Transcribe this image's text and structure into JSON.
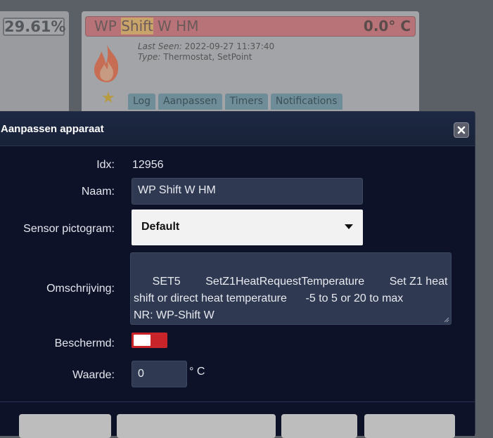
{
  "background": {
    "left_card": {
      "value": "29.61%"
    },
    "device_card": {
      "name_before": "WP ",
      "name_highlight": "Shift",
      "name_after": " W HM",
      "value": "0.0° C",
      "last_seen_label": "Last Seen:",
      "last_seen_value": "2022-09-27 11:37:40",
      "type_label": "Type:",
      "type_value": "Thermostat, SetPoint",
      "tabs": [
        "Log",
        "Aanpassen",
        "Timers",
        "Notifications"
      ]
    }
  },
  "dialog": {
    "title": "Aanpassen apparaat",
    "fields": {
      "idx": {
        "label": "Idx:",
        "value": "12956"
      },
      "naam": {
        "label": "Naam:",
        "value": "WP Shift W HM"
      },
      "sensor": {
        "label": "Sensor pictogram:",
        "value": "Default"
      },
      "omschrijving": {
        "label": "Omschrijving:",
        "value": "SET5        SetZ1HeatRequestTemperature        Set Z1 heat shift or direct heat temperature      -5 to 5 or 20 to max\nNR: WP-Shift W"
      },
      "beschermd": {
        "label": "Beschermd:",
        "state": "off"
      },
      "waarde": {
        "label": "Waarde:",
        "value": "0",
        "unit": "° C"
      }
    },
    "footer_buttons": [
      "",
      "",
      "",
      ""
    ]
  },
  "colors": {
    "dialog_bg": "#0e1229",
    "titlebar_bg": "#1d2844",
    "input_bg": "#2f3a52",
    "toggle_off": "#c9242a",
    "card_header": "#b77377"
  }
}
